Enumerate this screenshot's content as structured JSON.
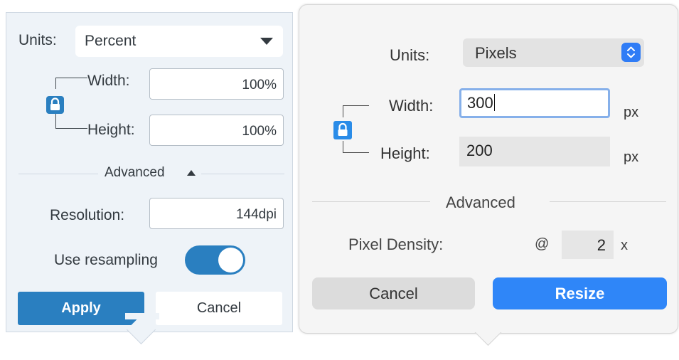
{
  "left_panel": {
    "units_label": "Units:",
    "units_value": "Percent",
    "width_label": "Width:",
    "width_value": "100%",
    "height_label": "Height:",
    "height_value": "100%",
    "advanced_label": "Advanced",
    "resolution_label": "Resolution:",
    "resolution_value": "144dpi",
    "resampling_label": "Use resampling",
    "resampling_on": true,
    "apply_label": "Apply",
    "cancel_label": "Cancel",
    "accent_color": "#2a7fc0",
    "icons": [
      "lock-icon",
      "dropdown-caret-icon",
      "disclosure-up-icon"
    ]
  },
  "right_panel": {
    "units_label": "Units:",
    "units_value": "Pixels",
    "width_label": "Width:",
    "width_value": "300",
    "width_unit": "px",
    "height_label": "Height:",
    "height_value": "200",
    "height_unit": "px",
    "advanced_label": "Advanced",
    "density_label": "Pixel Density:",
    "density_prefix": "@",
    "density_value": "2",
    "density_suffix": "x",
    "cancel_label": "Cancel",
    "resize_label": "Resize",
    "accent_color": "#2f86f8",
    "icons": [
      "lock-icon",
      "stepper-chevrons-icon"
    ]
  }
}
